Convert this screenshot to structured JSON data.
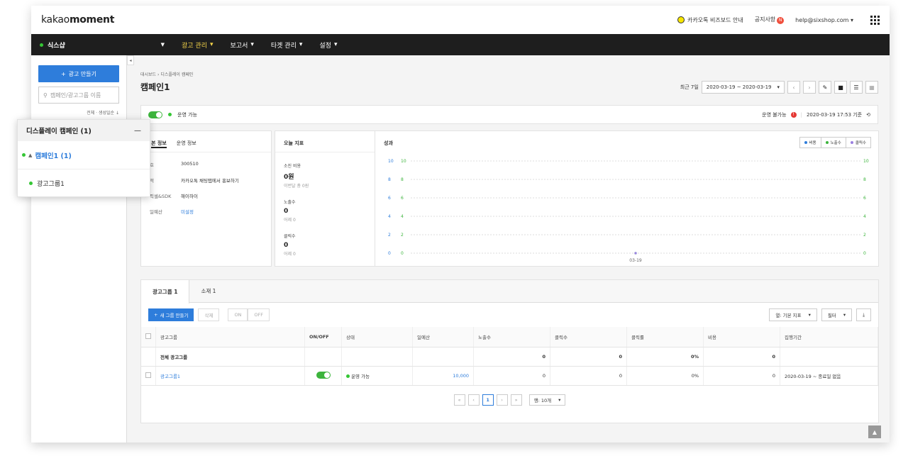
{
  "brand": {
    "logo_prefix": "kakao",
    "logo_suffix": "moment"
  },
  "topbar": {
    "kakaotalk_link": "카카오톡 비즈보드 안내",
    "notice": "공지사항",
    "notice_badge": "N",
    "account_email": "help@sixshop.com"
  },
  "nav": {
    "account": "식스샵",
    "items": [
      {
        "label": "광고 관리",
        "active": true
      },
      {
        "label": "보고서",
        "active": false
      },
      {
        "label": "타겟 관리",
        "active": false
      },
      {
        "label": "설정",
        "active": false
      }
    ]
  },
  "sidebar": {
    "create_label": "광고 만들기",
    "search_placeholder": "캠페인/광고그룹 이름",
    "sort_label": "전체 · 생성일순 ↓"
  },
  "tree_popup": {
    "header": "디스플레이 캠페인 (1)",
    "campaign": "캠페인1 (1)",
    "adgroup": "광고그룹1"
  },
  "header": {
    "breadcrumb_1": "대시보드",
    "breadcrumb_2": "디스플레이 캠페인",
    "title": "캠페인1",
    "period_label": "최근 7일",
    "date_range": "2020-03-19 ~ 2020-03-19"
  },
  "status": {
    "label": "운영 가능",
    "review_label": "운영 불가능",
    "updated": "2020-03-19 17:53 기준"
  },
  "basic_info": {
    "tab_1": "본 정보",
    "tab_2": "운영 정보",
    "rows": [
      {
        "k": "호",
        "v": "300510",
        "link": false
      },
      {
        "k": "적",
        "v": "카카오톡 채팅탭에서 홍보하기",
        "link": false
      },
      {
        "k": "픽셀&SDK",
        "v": "해이하이",
        "link": false
      },
      {
        "k": "일예산",
        "v": "미설정",
        "link": true
      }
    ]
  },
  "metrics": {
    "title": "오늘 지표",
    "items": [
      {
        "label": "소진 비용",
        "value": "0원",
        "sub": "이번달 총 0원"
      },
      {
        "label": "노출수",
        "value": "0",
        "sub": "어제 0"
      },
      {
        "label": "클릭수",
        "value": "0",
        "sub": "어제 0"
      }
    ]
  },
  "performance": {
    "title": "성과",
    "legend": [
      {
        "name": "비용",
        "color": "#2e7ddb"
      },
      {
        "name": "노출수",
        "color": "#3cb43c"
      },
      {
        "name": "클릭수",
        "color": "#9a7fe0"
      }
    ]
  },
  "chart_data": {
    "type": "line",
    "x": [
      "03-19"
    ],
    "series": [
      {
        "name": "비용",
        "values": [
          0
        ]
      },
      {
        "name": "노출수",
        "values": [
          0
        ]
      },
      {
        "name": "클릭수",
        "values": [
          0
        ]
      }
    ],
    "y_ticks_left_a": [
      10,
      8,
      6,
      4,
      2,
      0
    ],
    "y_ticks_left_b": [
      10,
      8,
      6,
      4,
      2,
      0
    ],
    "y_ticks_right": [
      10,
      8,
      6,
      4,
      2,
      0
    ],
    "ylim": [
      0,
      10
    ],
    "grid": true
  },
  "bottom": {
    "tab_adgroup": "광고그룹 1",
    "tab_creative": "소재 1",
    "new_group": "새 그룹 만들기",
    "delete": "삭제",
    "on": "ON",
    "off": "OFF",
    "column_select": "열: 기본 지표",
    "filter": "필터",
    "columns": [
      "광고그룹",
      "ON/OFF",
      "상태",
      "일예산",
      "노출수",
      "클릭수",
      "클릭률",
      "비용",
      "집행기간"
    ],
    "total_row": {
      "name": "전체 광고그룹",
      "impressions": "0",
      "clicks": "0",
      "ctr": "0%",
      "cost": "0"
    },
    "rows": [
      {
        "name": "광고그룹1",
        "status": "운영 가능",
        "budget": "10,000",
        "impressions": "0",
        "clicks": "0",
        "ctr": "0%",
        "cost": "0",
        "period": "2020-03-19 ~ 종료일 없음"
      }
    ],
    "page": "1",
    "rows_per_page": "행: 10개"
  }
}
